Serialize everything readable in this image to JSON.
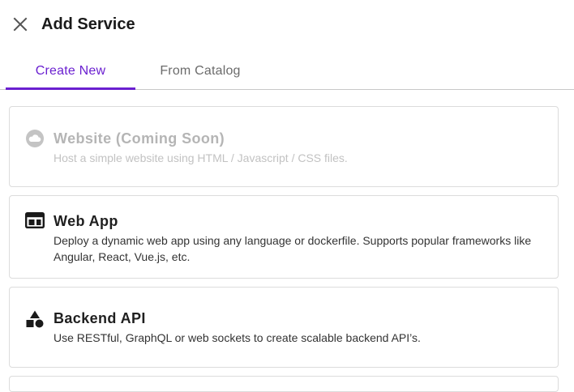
{
  "header": {
    "title": "Add Service",
    "close_icon": "close-icon"
  },
  "tabs": [
    {
      "label": "Create New",
      "active": true
    },
    {
      "label": "From Catalog",
      "active": false
    }
  ],
  "colors": {
    "accent": "#6a1fd0",
    "disabled_text": "#b5b5b5"
  },
  "services": [
    {
      "title": "Website (Coming Soon)",
      "description": "Host a simple website using HTML / Javascript / CSS files.",
      "icon": "cloud-icon",
      "disabled": true
    },
    {
      "title": "Web App",
      "description": "Deploy a dynamic web app using any language or dockerfile. Supports popular frameworks like Angular, React, Vue.js, etc.",
      "icon": "web-window-icon",
      "disabled": false
    },
    {
      "title": "Backend API",
      "description": "Use RESTful, GraphQL or web sockets to create scalable backend API’s.",
      "icon": "shapes-icon",
      "disabled": false
    }
  ]
}
